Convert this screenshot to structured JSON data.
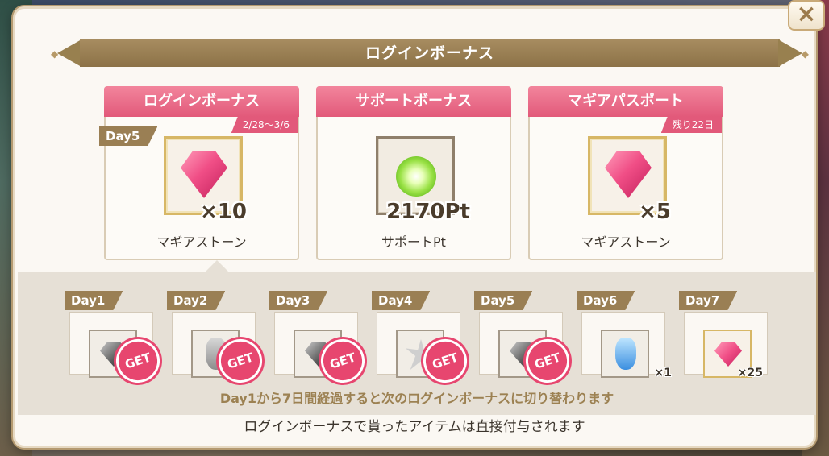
{
  "title": "ログインボーナス",
  "close_icon": "×",
  "cards": [
    {
      "header": "ログインボーナス",
      "sub": "2/28～3/6",
      "day": "Day5",
      "qty": "×10",
      "name": "マギアストーン",
      "icon": "magia-stone-icon"
    },
    {
      "header": "サポートボーナス",
      "sub": "",
      "day": "",
      "qty": "2170Pt",
      "name": "サポートPt",
      "icon": "support-point-icon"
    },
    {
      "header": "マギアパスポート",
      "sub": "残り22日",
      "day": "",
      "qty": "×5",
      "name": "マギアストーン",
      "icon": "magia-stone-icon"
    }
  ],
  "days": [
    {
      "label": "Day1",
      "icon": "stone-icon",
      "qty": "",
      "got": true,
      "get": "GET"
    },
    {
      "label": "Day2",
      "icon": "potion-icon",
      "qty": "",
      "got": true,
      "get": "GET"
    },
    {
      "label": "Day3",
      "icon": "stone-icon",
      "qty": "",
      "got": true,
      "get": "GET"
    },
    {
      "label": "Day4",
      "icon": "burst-icon",
      "qty": "",
      "got": true,
      "get": "GET"
    },
    {
      "label": "Day5",
      "icon": "stone-icon",
      "qty": "",
      "got": true,
      "get": "GET"
    },
    {
      "label": "Day6",
      "icon": "blue-potion-icon",
      "qty": "×1",
      "got": false,
      "get": ""
    },
    {
      "label": "Day7",
      "icon": "magia-stone-icon",
      "qty": "×25",
      "got": false,
      "get": ""
    }
  ],
  "strip_note": "Day1から7日間経過すると次のログインボーナスに切り替わります",
  "footer_note": "ログインボーナスで貰ったアイテムは直接付与されます",
  "colors": {
    "accent_pink": "#e2597a",
    "gold": "#9a7f54",
    "get_badge": "#e7466f"
  }
}
